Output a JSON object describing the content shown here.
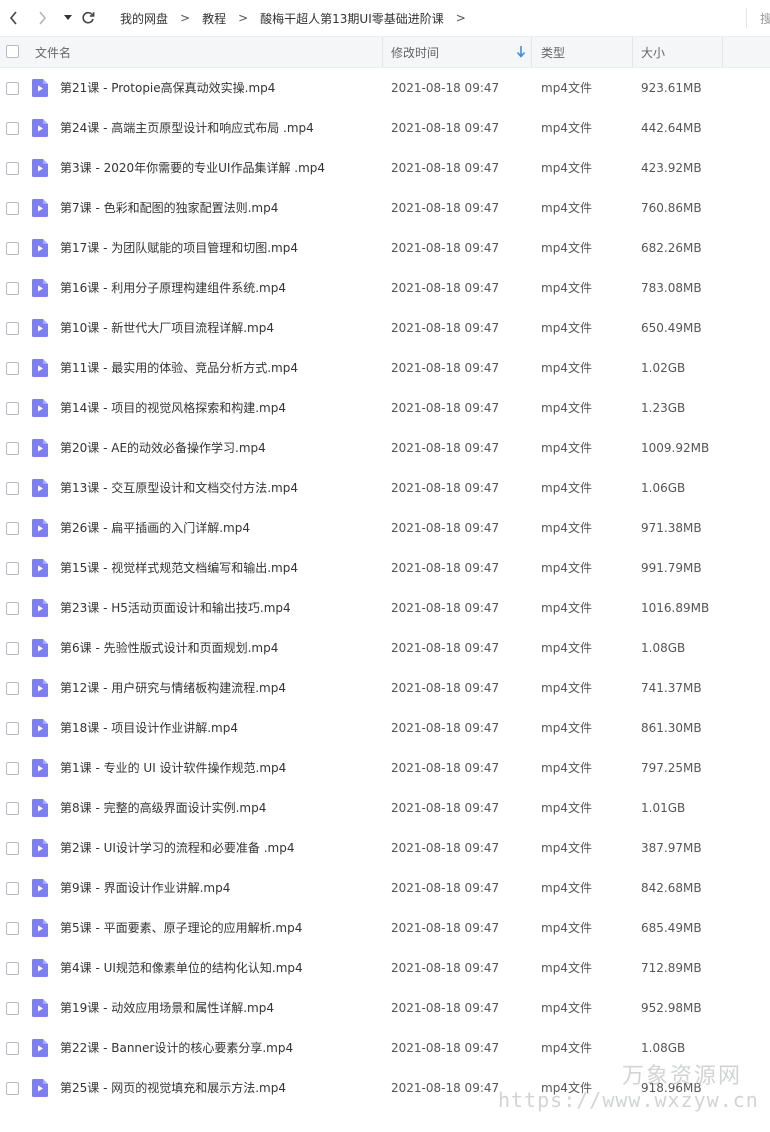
{
  "breadcrumb": {
    "items": [
      "我的网盘",
      "教程",
      "酸梅干超人第13期UI零基础进阶课"
    ],
    "separator": ">"
  },
  "toolbar": {
    "search_partial": "搜"
  },
  "columns": {
    "name": "文件名",
    "modified": "修改时间",
    "type": "类型",
    "size": "大小"
  },
  "colors": {
    "accent": "#3a8ee6",
    "file_icon": "#7d7ff0",
    "header_bg": "#f5f6f8",
    "watermark": "#c9ccd1"
  },
  "files": [
    {
      "name": "第21课 - Protopie高保真动效实操.mp4",
      "modified": "2021-08-18 09:47",
      "type": "mp4文件",
      "size": "923.61MB"
    },
    {
      "name": "第24课 - 高端主页原型设计和响应式布局 .mp4",
      "modified": "2021-08-18 09:47",
      "type": "mp4文件",
      "size": "442.64MB"
    },
    {
      "name": "第3课 - 2020年你需要的专业UI作品集详解 .mp4",
      "modified": "2021-08-18 09:47",
      "type": "mp4文件",
      "size": "423.92MB"
    },
    {
      "name": "第7课 - 色彩和配图的独家配置法则.mp4",
      "modified": "2021-08-18 09:47",
      "type": "mp4文件",
      "size": "760.86MB"
    },
    {
      "name": "第17课 - 为团队赋能的项目管理和切图.mp4",
      "modified": "2021-08-18 09:47",
      "type": "mp4文件",
      "size": "682.26MB"
    },
    {
      "name": "第16课 - 利用分子原理构建组件系统.mp4",
      "modified": "2021-08-18 09:47",
      "type": "mp4文件",
      "size": "783.08MB"
    },
    {
      "name": "第10课 - 新世代大厂项目流程详解.mp4",
      "modified": "2021-08-18 09:47",
      "type": "mp4文件",
      "size": "650.49MB"
    },
    {
      "name": "第11课 - 最实用的体验、竞品分析方式.mp4",
      "modified": "2021-08-18 09:47",
      "type": "mp4文件",
      "size": "1.02GB"
    },
    {
      "name": "第14课 - 项目的视觉风格探索和构建.mp4",
      "modified": "2021-08-18 09:47",
      "type": "mp4文件",
      "size": "1.23GB"
    },
    {
      "name": "第20课 - AE的动效必备操作学习.mp4",
      "modified": "2021-08-18 09:47",
      "type": "mp4文件",
      "size": "1009.92MB"
    },
    {
      "name": "第13课 - 交互原型设计和文档交付方法.mp4",
      "modified": "2021-08-18 09:47",
      "type": "mp4文件",
      "size": "1.06GB"
    },
    {
      "name": "第26课 - 扁平插画的入门详解.mp4",
      "modified": "2021-08-18 09:47",
      "type": "mp4文件",
      "size": "971.38MB"
    },
    {
      "name": "第15课 - 视觉样式规范文档编写和输出.mp4",
      "modified": "2021-08-18 09:47",
      "type": "mp4文件",
      "size": "991.79MB"
    },
    {
      "name": "第23课 - H5活动页面设计和输出技巧.mp4",
      "modified": "2021-08-18 09:47",
      "type": "mp4文件",
      "size": "1016.89MB"
    },
    {
      "name": "第6课 - 先验性版式设计和页面规划.mp4",
      "modified": "2021-08-18 09:47",
      "type": "mp4文件",
      "size": "1.08GB"
    },
    {
      "name": "第12课 - 用户研究与情绪板构建流程.mp4",
      "modified": "2021-08-18 09:47",
      "type": "mp4文件",
      "size": "741.37MB"
    },
    {
      "name": "第18课 - 项目设计作业讲解.mp4",
      "modified": "2021-08-18 09:47",
      "type": "mp4文件",
      "size": "861.30MB"
    },
    {
      "name": "第1课 - 专业的 UI 设计软件操作规范.mp4",
      "modified": "2021-08-18 09:47",
      "type": "mp4文件",
      "size": "797.25MB"
    },
    {
      "name": "第8课 - 完整的高级界面设计实例.mp4",
      "modified": "2021-08-18 09:47",
      "type": "mp4文件",
      "size": "1.01GB"
    },
    {
      "name": "第2课 - UI设计学习的流程和必要准备 .mp4",
      "modified": "2021-08-18 09:47",
      "type": "mp4文件",
      "size": "387.97MB"
    },
    {
      "name": "第9课 - 界面设计作业讲解.mp4",
      "modified": "2021-08-18 09:47",
      "type": "mp4文件",
      "size": "842.68MB"
    },
    {
      "name": "第5课 - 平面要素、原子理论的应用解析.mp4",
      "modified": "2021-08-18 09:47",
      "type": "mp4文件",
      "size": "685.49MB"
    },
    {
      "name": "第4课 - UI规范和像素单位的结构化认知.mp4",
      "modified": "2021-08-18 09:47",
      "type": "mp4文件",
      "size": "712.89MB"
    },
    {
      "name": "第19课 - 动效应用场景和属性详解.mp4",
      "modified": "2021-08-18 09:47",
      "type": "mp4文件",
      "size": "952.98MB"
    },
    {
      "name": "第22课 - Banner设计的核心要素分享.mp4",
      "modified": "2021-08-18 09:47",
      "type": "mp4文件",
      "size": "1.08GB"
    },
    {
      "name": "第25课 - 网页的视觉填充和展示方法.mp4",
      "modified": "2021-08-18 09:47",
      "type": "mp4文件",
      "size": "918.96MB"
    }
  ],
  "watermark": {
    "text": "万象资源网",
    "url": "https://www.wxzyw.cn"
  }
}
